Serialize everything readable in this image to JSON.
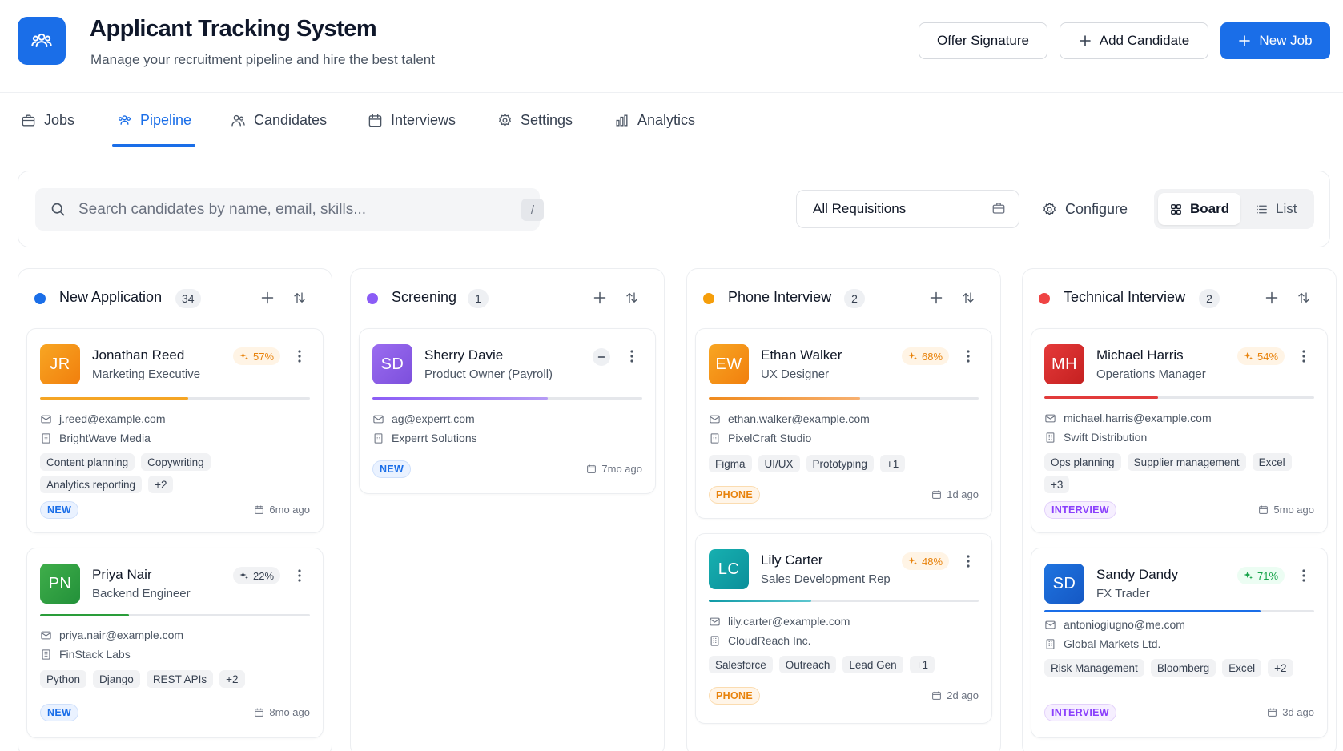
{
  "header": {
    "title": "Applicant Tracking System",
    "subtitle": "Manage your recruitment pipeline and hire the best talent",
    "offer_label": "Offer Signature",
    "add_label": "Add Candidate",
    "new_job_label": "New Job"
  },
  "tabs": [
    {
      "label": "Jobs",
      "icon": "briefcase-icon"
    },
    {
      "label": "Pipeline",
      "icon": "users-icon",
      "active": true
    },
    {
      "label": "Candidates",
      "icon": "user-group-icon"
    },
    {
      "label": "Interviews",
      "icon": "calendar-icon"
    },
    {
      "label": "Settings",
      "icon": "gear-icon"
    },
    {
      "label": "Analytics",
      "icon": "bar-chart-icon"
    }
  ],
  "toolbar": {
    "search_placeholder": "Search candidates by name, email, skills...",
    "search_shortcut": "/",
    "requisition": "All Requisitions",
    "configure_label": "Configure",
    "board_label": "Board",
    "list_label": "List"
  },
  "colors": {
    "accent": "#1a6ee8",
    "new_application": "#1a6ee8",
    "screening": "#8b5cf6",
    "phone_interview": "#f59e0b",
    "technical_interview": "#ef4444"
  },
  "columns": [
    {
      "title": "New Application",
      "count": "34",
      "cards": [
        {
          "initials": "JR",
          "name": "Jonathan Reed",
          "role": "Marketing Executive",
          "score": "57%",
          "email": "j.reed@example.com",
          "company": "BrightWave Media",
          "tags": [
            "Content planning",
            "Copywriting",
            "Analytics reporting",
            "+2"
          ],
          "status": "NEW",
          "ago": "6mo ago",
          "progress": 0.55
        },
        {
          "initials": "PN",
          "name": "Priya Nair",
          "role": "Backend Engineer",
          "score": "22%",
          "email": "priya.nair@example.com",
          "company": "FinStack Labs",
          "tags": [
            "Python",
            "Django",
            "REST APIs",
            "+2"
          ],
          "status": "NEW",
          "ago": "8mo ago",
          "progress": 0.33
        }
      ]
    },
    {
      "title": "Screening",
      "count": "1",
      "cards": [
        {
          "initials": "SD",
          "name": "Sherry Davie",
          "role": "Product Owner (Payroll)",
          "email": "ag@experrt.com",
          "company": "Experrt Solutions",
          "status": "NEW",
          "ago": "7mo ago",
          "progress": 0.65
        }
      ]
    },
    {
      "title": "Phone Interview",
      "count": "2",
      "cards": [
        {
          "initials": "EW",
          "name": "Ethan Walker",
          "role": "UX Designer",
          "score": "68%",
          "email": "ethan.walker@example.com",
          "company": "PixelCraft Studio",
          "tags": [
            "Figma",
            "UI/UX",
            "Prototyping",
            "+1"
          ],
          "status": "PHONE",
          "ago": "1d ago",
          "progress": 0.56
        },
        {
          "initials": "LC",
          "name": "Lily Carter",
          "role": "Sales Development Rep",
          "score": "48%",
          "email": "lily.carter@example.com",
          "company": "CloudReach Inc.",
          "tags": [
            "Salesforce",
            "Outreach",
            "Lead Gen",
            "+1"
          ],
          "status": "PHONE",
          "ago": "2d ago",
          "progress": 0.38
        }
      ]
    },
    {
      "title": "Technical Interview",
      "count": "2",
      "cards": [
        {
          "initials": "MH",
          "name": "Michael Harris",
          "role": "Operations Manager",
          "score": "54%",
          "email": "michael.harris@example.com",
          "company": "Swift Distribution",
          "tags": [
            "Ops planning",
            "Supplier management",
            "Excel",
            "+3"
          ],
          "status": "INTERVIEW",
          "ago": "5mo ago",
          "progress": 0.42
        },
        {
          "initials": "SD",
          "name": "Sandy Dandy",
          "role": "FX Trader",
          "score": "71%",
          "email": "antoniogiugno@me.com",
          "company": "Global Markets Ltd.",
          "tags": [
            "Risk Management",
            "Bloomberg",
            "Excel",
            "+2"
          ],
          "status": "INTERVIEW",
          "ago": "3d ago",
          "progress": 0.8
        }
      ]
    }
  ]
}
